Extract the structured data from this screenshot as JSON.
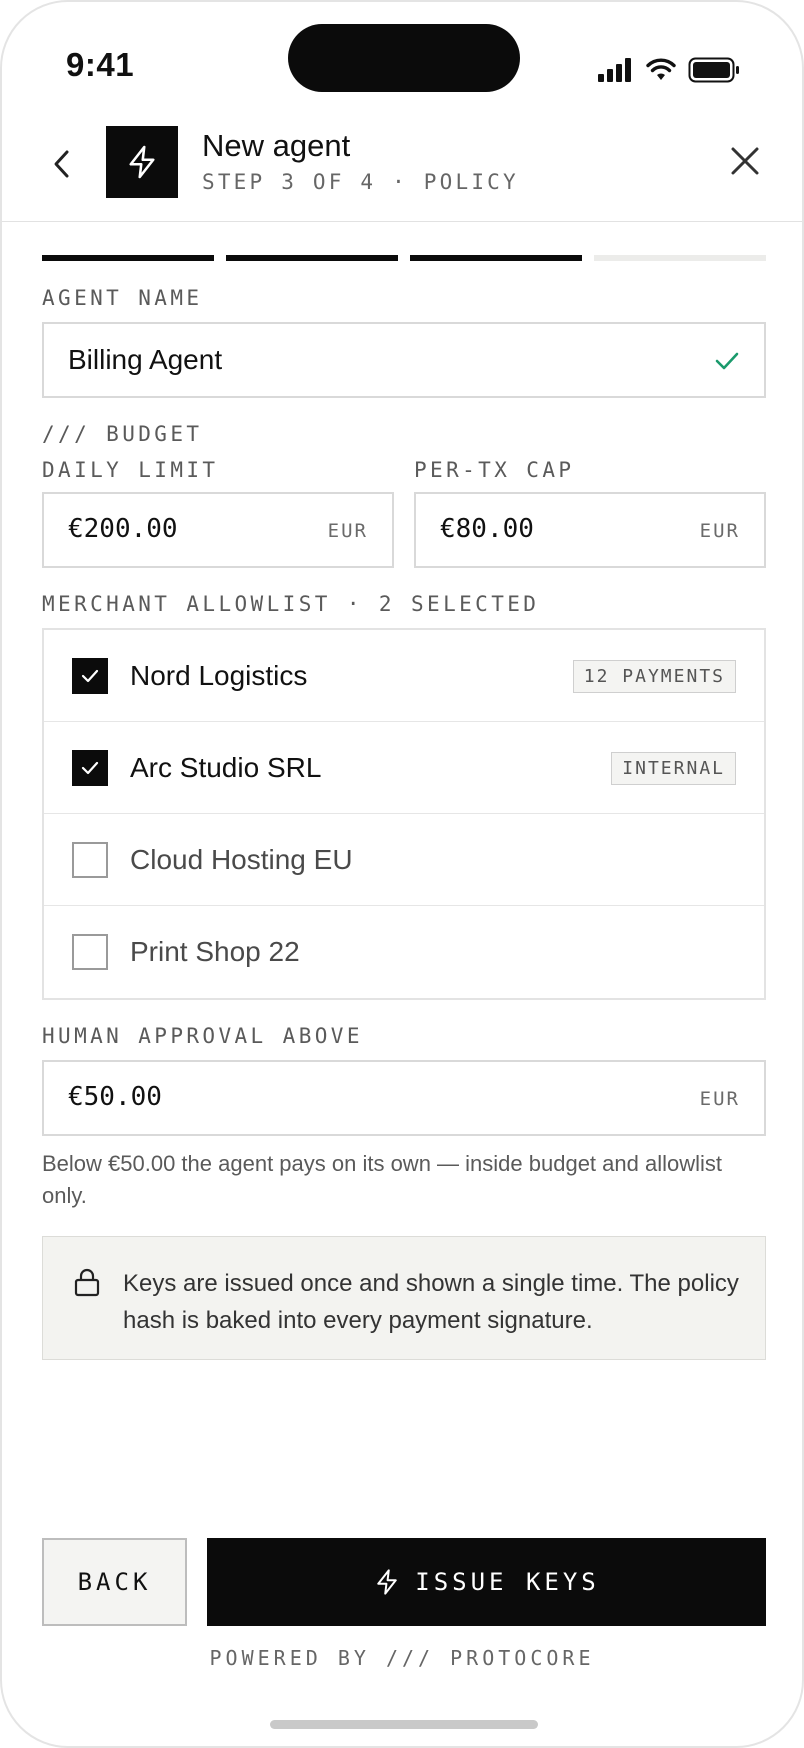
{
  "status": {
    "time": "9:41"
  },
  "header": {
    "title": "New agent",
    "subtitle": "STEP 3 OF 4 · POLICY"
  },
  "progress": {
    "total_steps": 4,
    "completed_steps": 3
  },
  "agent_name": {
    "label": "AGENT NAME",
    "value": "Billing Agent",
    "accent": "#1a9a6c"
  },
  "budget": {
    "section_label": "/// BUDGET",
    "daily_limit": {
      "label": "DAILY LIMIT",
      "value": "€200.00",
      "currency": "EUR"
    },
    "per_tx_cap": {
      "label": "PER-TX CAP",
      "value": "€80.00",
      "currency": "EUR"
    }
  },
  "allowlist": {
    "label": "MERCHANT ALLOWLIST · 2 SELECTED",
    "items": [
      {
        "name": "Nord Logistics",
        "checked": true,
        "badge": "12 PAYMENTS"
      },
      {
        "name": "Arc Studio SRL",
        "checked": true,
        "badge": "INTERNAL"
      },
      {
        "name": "Cloud Hosting EU",
        "checked": false
      },
      {
        "name": "Print Shop 22",
        "checked": false
      }
    ]
  },
  "approval": {
    "label": "HUMAN APPROVAL ABOVE",
    "value": "€50.00",
    "currency": "EUR",
    "helper": "Below €50.00 the agent pays on its own — inside budget and allowlist only."
  },
  "notice": {
    "icon": "lock-icon",
    "text": "Keys are issued once and shown a single time. The policy hash is baked into every payment signature."
  },
  "footer": {
    "back_label": "BACK",
    "issue_label": "ISSUE KEYS",
    "powered": "POWERED BY /// PROTOCORE"
  }
}
